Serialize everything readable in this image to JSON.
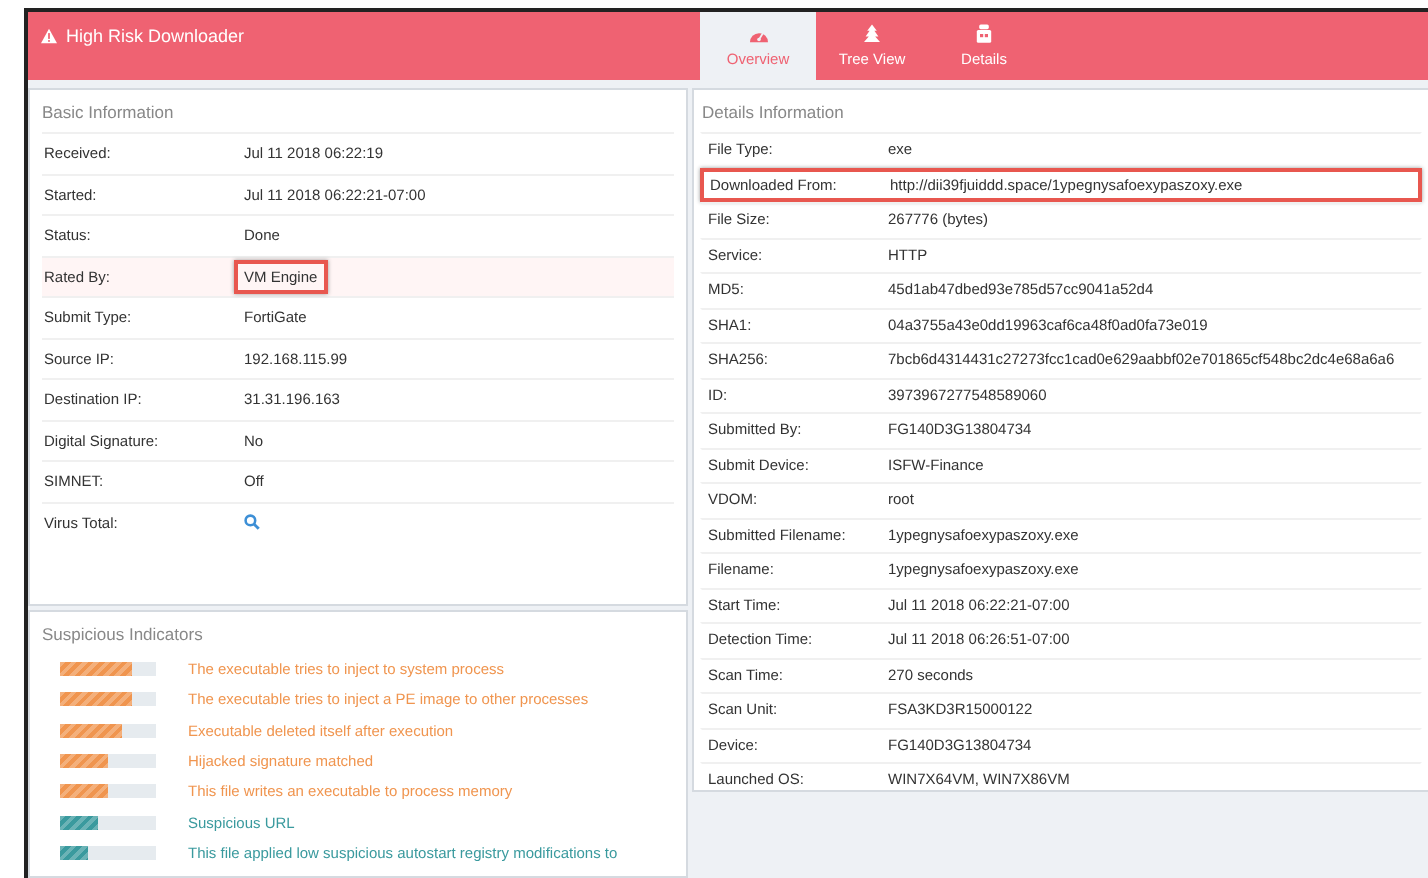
{
  "header": {
    "title": "High Risk Downloader",
    "tabs": [
      {
        "label": "Overview",
        "kind": "overview",
        "selected": true
      },
      {
        "label": "Tree View",
        "kind": "tree",
        "selected": false
      },
      {
        "label": "Details",
        "kind": "details",
        "selected": false
      }
    ]
  },
  "basic_information": {
    "title": "Basic Information",
    "rows": [
      {
        "label": "Received:",
        "value": "Jul 11 2018 06:22:19",
        "highlighted": false
      },
      {
        "label": "Started:",
        "value": "Jul 11 2018 06:22:21-07:00",
        "highlighted": false
      },
      {
        "label": "Status:",
        "value": "Done",
        "highlighted": false
      },
      {
        "label": "Rated By:",
        "value": "VM Engine",
        "highlighted": true
      },
      {
        "label": "Submit Type:",
        "value": "FortiGate",
        "highlighted": false
      },
      {
        "label": "Source IP:",
        "value": "192.168.115.99",
        "highlighted": false
      },
      {
        "label": "Destination IP:",
        "value": "31.31.196.163",
        "highlighted": false
      },
      {
        "label": "Digital Signature:",
        "value": "No",
        "highlighted": false
      },
      {
        "label": "SIMNET:",
        "value": "Off",
        "highlighted": false
      },
      {
        "label": "Virus Total:",
        "kind": "search",
        "highlighted": false
      }
    ]
  },
  "suspicious_indicators": {
    "title": "Suspicious Indicators",
    "items": [
      {
        "text": "The executable tries to inject to system process",
        "level": 0.75,
        "color": "#f0954f"
      },
      {
        "text": "The executable tries to inject a PE image to other processes",
        "level": 0.75,
        "color": "#f0954f"
      },
      {
        "text": "Executable deleted itself after execution",
        "level": 0.65,
        "color": "#f0954f"
      },
      {
        "text": "Hijacked signature matched",
        "level": 0.5,
        "color": "#f0954f"
      },
      {
        "text": "This file writes an executable to process memory",
        "level": 0.5,
        "color": "#f0954f"
      },
      {
        "text": "Suspicious URL",
        "level": 0.4,
        "color": "#3a9a9e"
      },
      {
        "text": "This file applied low suspicious autostart registry modifications to",
        "level": 0.3,
        "color": "#3a9a9e"
      }
    ]
  },
  "details_information": {
    "title": "Details Information",
    "rows": [
      {
        "label": "File Type:",
        "value": "exe",
        "highlighted": false
      },
      {
        "label": "Downloaded From:",
        "value": "http://dii39fjuiddd.space/1ypegnysafoexypaszoxy.exe",
        "highlighted": true
      },
      {
        "label": "File Size:",
        "value": "267776 (bytes)",
        "highlighted": false
      },
      {
        "label": "Service:",
        "value": "HTTP",
        "highlighted": false
      },
      {
        "label": "MD5:",
        "value": "45d1ab47dbed93e785d57cc9041a52d4",
        "highlighted": false
      },
      {
        "label": "SHA1:",
        "value": "04a3755a43e0dd19963caf6ca48f0ad0fa73e019",
        "highlighted": false
      },
      {
        "label": "SHA256:",
        "value": "7bcb6d4314431c27273fcc1cad0e629aabbf02e701865cf548bc2dc4e68a6a6",
        "highlighted": false
      },
      {
        "label": "ID:",
        "value": "3973967277548589060",
        "highlighted": false
      },
      {
        "label": "Submitted By:",
        "value": "FG140D3G13804734",
        "highlighted": false
      },
      {
        "label": "Submit Device:",
        "value": "ISFW-Finance",
        "highlighted": false
      },
      {
        "label": "VDOM:",
        "value": "root",
        "highlighted": false
      },
      {
        "label": "Submitted Filename:",
        "value": "1ypegnysafoexypaszoxy.exe",
        "highlighted": false
      },
      {
        "label": "Filename:",
        "value": "1ypegnysafoexypaszoxy.exe",
        "highlighted": false
      },
      {
        "label": "Start Time:",
        "value": "Jul 11 2018 06:22:21-07:00",
        "highlighted": false
      },
      {
        "label": "Detection Time:",
        "value": "Jul 11 2018 06:26:51-07:00",
        "highlighted": false
      },
      {
        "label": "Scan Time:",
        "value": "270 seconds",
        "highlighted": false
      },
      {
        "label": "Scan Unit:",
        "value": "FSA3KD3R15000122",
        "highlighted": false
      },
      {
        "label": "Device:",
        "value": "FG140D3G13804734",
        "highlighted": false
      },
      {
        "label": "Launched OS:",
        "value": "WIN7X64VM, WIN7X86VM",
        "highlighted": false
      }
    ]
  }
}
